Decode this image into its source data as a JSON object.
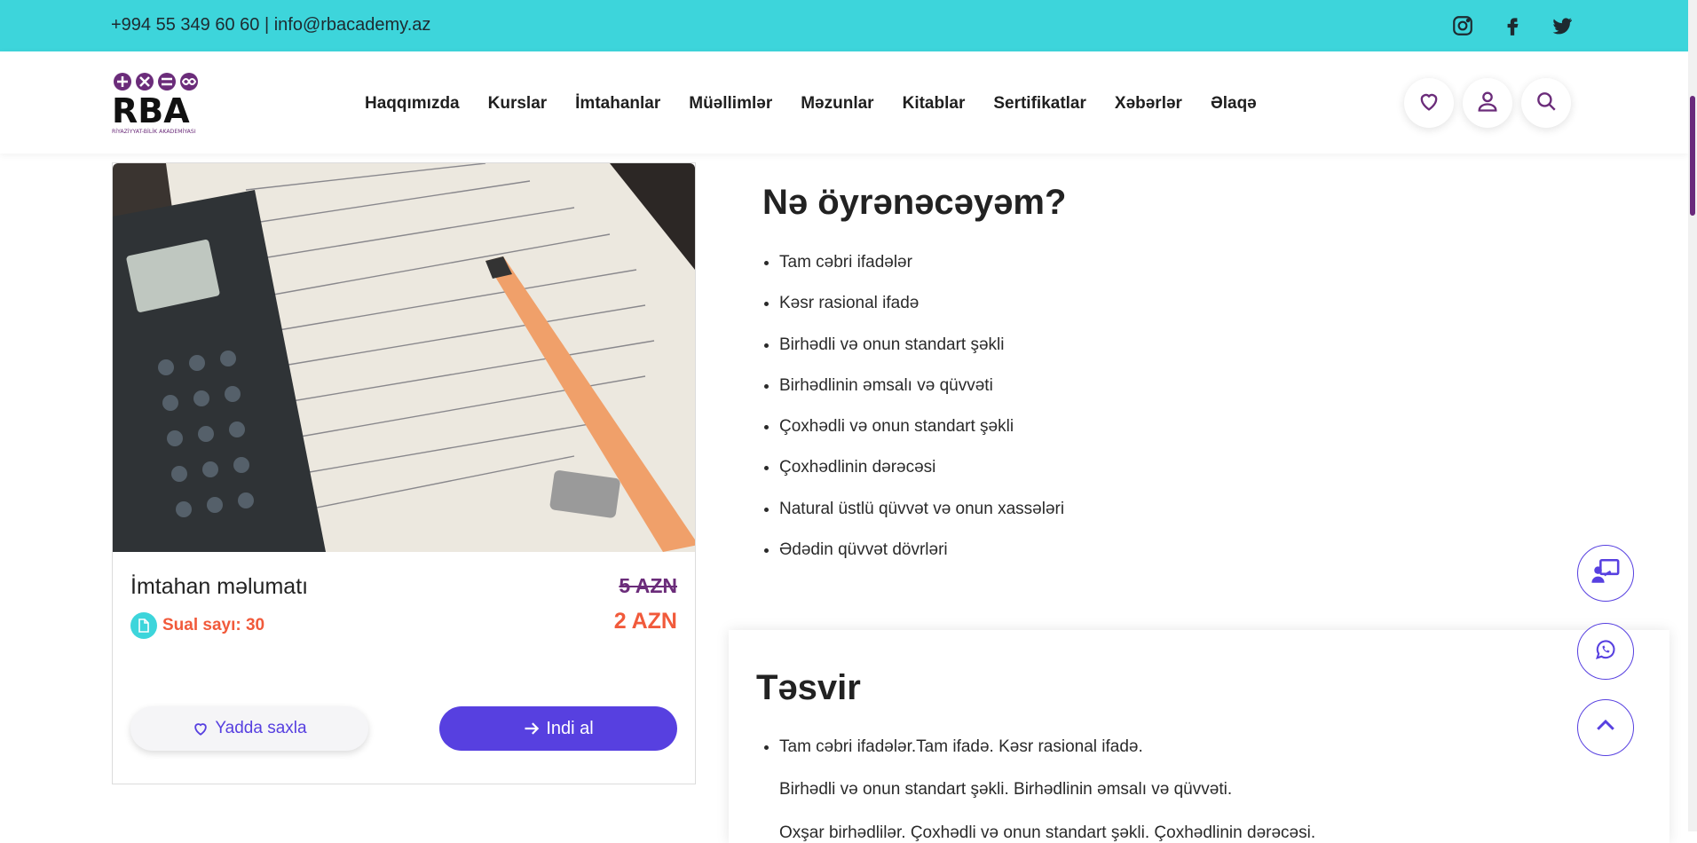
{
  "topbar": {
    "contact": "+994 55 349 60 60 | info@rbacademy.az",
    "social": [
      {
        "icon": "instagram-icon"
      },
      {
        "icon": "facebook-icon"
      },
      {
        "icon": "twitter-icon"
      }
    ]
  },
  "logo": {
    "text": "RBA",
    "subtitle": "RİYAZİYYAT-BİLİK AKADEMİYASI"
  },
  "nav": {
    "items": [
      "Haqqımızda",
      "Kurslar",
      "İmtahanlar",
      "Müəllimlər",
      "Məzunlar",
      "Kitablar",
      "Sertifikatlar",
      "Xəbərlər",
      "Əlaqə"
    ]
  },
  "header_actions": [
    {
      "icon": "heart-icon"
    },
    {
      "icon": "user-icon"
    },
    {
      "icon": "search-icon"
    }
  ],
  "card": {
    "image_alt": "calculator-and-math-notes-photo",
    "title": "İmtahan məlumatı",
    "old_price": "5 AZN",
    "new_price": "2 AZN",
    "question_count": "Sual sayı: 30",
    "save_label": "Yadda saxla",
    "buy_label": "Indi al"
  },
  "learn": {
    "title": "Nə öyrənəcəyəm?",
    "items": [
      "Tam cəbri ifadələr",
      "Kəsr rasional ifadə",
      "Birhədli və onun standart şəkli",
      "Birhədlinin əmsalı və qüvvəti",
      "Çoxhədli və onun standart şəkli",
      "Çoxhədlinin dərəcəsi",
      "Natural üstlü qüvvət və onun xassələri",
      "Ədədin qüvvət dövrləri"
    ]
  },
  "description": {
    "title": "Təsvir",
    "line1": "Tam cəbri ifadələr.Tam ifadə. Kəsr rasional ifadə.",
    "line2": "Birhədli və onun standart şəkli. Birhədlinin əmsalı və qüvvəti.",
    "line3": "Oxşar birhədlilər. Çoxhədli və onun standart şəkli. Çoxhədlinin dərəcəsi."
  },
  "colors": {
    "topbar": "#3dd5db",
    "brand_purple": "#6b2c7a",
    "accent": "#5740e0",
    "price_red": "#f15a3b"
  }
}
